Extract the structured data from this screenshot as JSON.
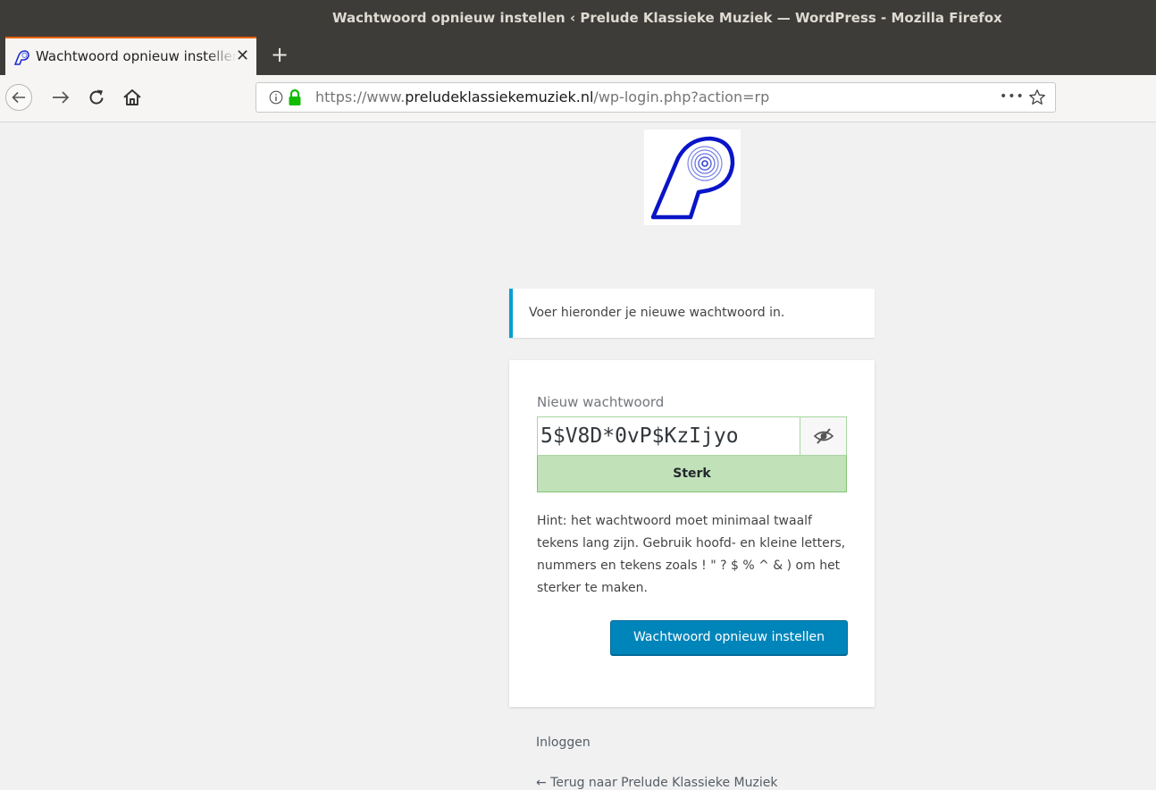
{
  "window": {
    "title": "Wachtwoord opnieuw instellen ‹ Prelude Klassieke Muziek — WordPress - Mozilla Firefox"
  },
  "tabs": [
    {
      "title": "Wachtwoord opnieuw instellen ‹ Prelude Klassieke Muziek — WordPress",
      "close_label": "✕",
      "icon": "prelude-logo-icon"
    }
  ],
  "new_tab_label": "+",
  "navbar": {
    "back_icon": "back-arrow-icon",
    "forward_icon": "forward-arrow-icon",
    "reload_icon": "reload-icon",
    "home_icon": "home-icon",
    "url": {
      "prefix": "https://www.",
      "domain": "preludeklassiekemuziek.nl",
      "path": "/wp-login.php?action=rp"
    },
    "page_actions_label": "•••"
  },
  "colors": {
    "titlebar": "#3d3c38",
    "tab_accent": "#e66000",
    "message_accent": "#00a0d2",
    "strength_bg": "#c1e1b9",
    "button": "#0085ba",
    "logo_blue": "#0a14c8"
  },
  "message": {
    "text": "Voer hieronder je nieuwe wachtwoord in."
  },
  "form": {
    "password_label": "Nieuw wachtwoord",
    "password_value": "5$V8D*0vP$KzIjyo",
    "toggle_icon": "eye-slash-icon",
    "strength_label": "Sterk",
    "hint": "Hint: het wachtwoord moet minimaal twaalf tekens lang zijn. Gebruik hoofd- en kleine letters, nummers en tekens zoals ! \" ? $ % ^ & ) om het sterker te maken.",
    "submit_label": "Wachtwoord opnieuw instellen"
  },
  "footer_links": {
    "login": "Inloggen",
    "back_to_site": "← Terug naar Prelude Klassieke Muziek"
  }
}
